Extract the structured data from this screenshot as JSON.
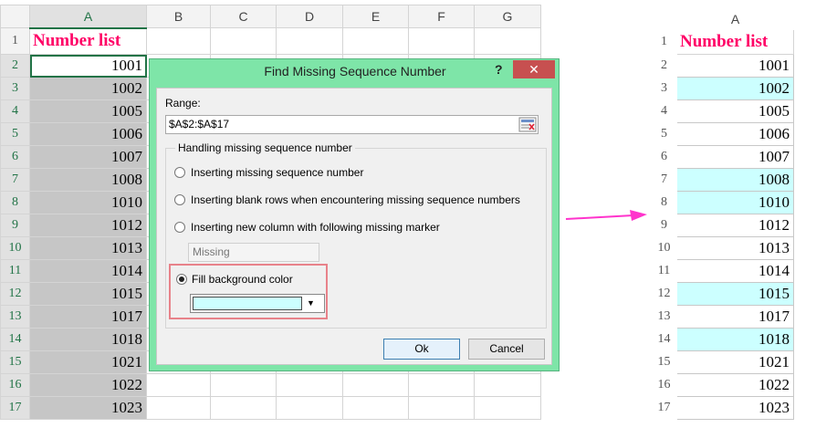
{
  "left_sheet": {
    "column_headers": [
      "A",
      "B",
      "C",
      "D",
      "E",
      "F",
      "G"
    ],
    "row_numbers": [
      "1",
      "2",
      "3",
      "4",
      "5",
      "6",
      "7",
      "8",
      "9",
      "10",
      "11",
      "12",
      "13",
      "14",
      "15",
      "16",
      "17"
    ],
    "header_cell": "Number list",
    "values": [
      "1001",
      "1002",
      "1005",
      "1006",
      "1007",
      "1008",
      "1010",
      "1012",
      "1013",
      "1014",
      "1015",
      "1017",
      "1018",
      "1021",
      "1022",
      "1023"
    ]
  },
  "dialog": {
    "title": "Find Missing Sequence Number",
    "help_label": "?",
    "close_label": "✕",
    "range_label": "Range:",
    "range_value": "$A$2:$A$17",
    "group_title": "Handling missing sequence number",
    "options": [
      "Inserting missing sequence number",
      "Inserting blank rows when encountering missing sequence numbers",
      "Inserting new column with following missing marker",
      "Fill background color"
    ],
    "selected_option": 3,
    "marker_placeholder": "Missing",
    "fill_color": "#ccffff",
    "ok_label": "Ok",
    "cancel_label": "Cancel"
  },
  "right_sheet": {
    "column_header": "A",
    "row_numbers": [
      "1",
      "2",
      "3",
      "4",
      "5",
      "6",
      "7",
      "8",
      "9",
      "10",
      "11",
      "12",
      "13",
      "14",
      "15",
      "16",
      "17"
    ],
    "header_cell": "Number list",
    "values": [
      "1001",
      "1002",
      "1005",
      "1006",
      "1007",
      "1008",
      "1010",
      "1012",
      "1013",
      "1014",
      "1015",
      "1017",
      "1018",
      "1021",
      "1022",
      "1023"
    ],
    "highlighted_rows": [
      "3",
      "7",
      "8",
      "12",
      "14"
    ],
    "highlight_color": "#ccffff"
  },
  "arrow_color": "#ff33cc",
  "icons": [
    "range-select-icon",
    "dropdown-arrow-icon",
    "arrow-right-icon"
  ]
}
